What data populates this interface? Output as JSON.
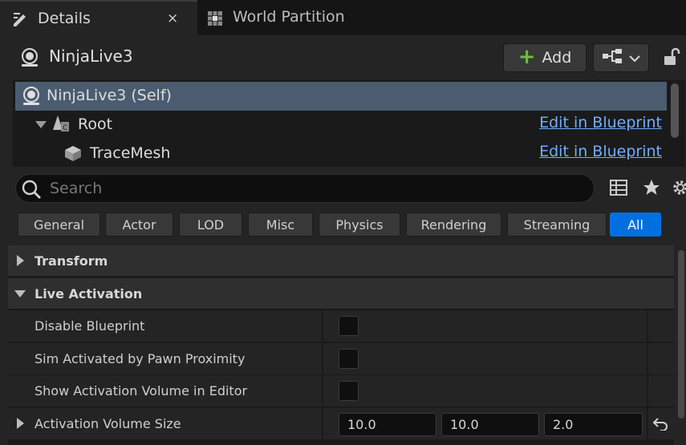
{
  "tabs": [
    {
      "label": "Details",
      "close": "×"
    },
    {
      "label": "World Partition"
    }
  ],
  "header": {
    "actor_name": "NinjaLive3",
    "add_label": "Add"
  },
  "tree": {
    "items": [
      {
        "label": "NinjaLive3 (Self)"
      },
      {
        "label": "Root",
        "link": "Edit in Blueprint"
      },
      {
        "label": "TraceMesh",
        "link": "Edit in Blueprint"
      }
    ]
  },
  "search": {
    "placeholder": "Search",
    "value": ""
  },
  "filters": [
    "General",
    "Actor",
    "LOD",
    "Misc",
    "Physics",
    "Rendering",
    "Streaming",
    "All"
  ],
  "active_filter": "All",
  "details": {
    "transform": {
      "label": "Transform"
    },
    "live_activation": {
      "label": "Live Activation"
    },
    "props": [
      {
        "name": "Disable Blueprint",
        "checked": false
      },
      {
        "name": "Sim Activated by Pawn Proximity",
        "checked": false
      },
      {
        "name": "Show Activation Volume in Editor",
        "checked": false
      }
    ],
    "volume": {
      "name": "Activation Volume Size",
      "x": "10.0",
      "y": "10.0",
      "z": "2.0"
    }
  },
  "colors": {
    "accent": "#0070e0",
    "selection": "#4b5c70",
    "link": "#6faeff",
    "add_plus": "#6bbf3a"
  }
}
